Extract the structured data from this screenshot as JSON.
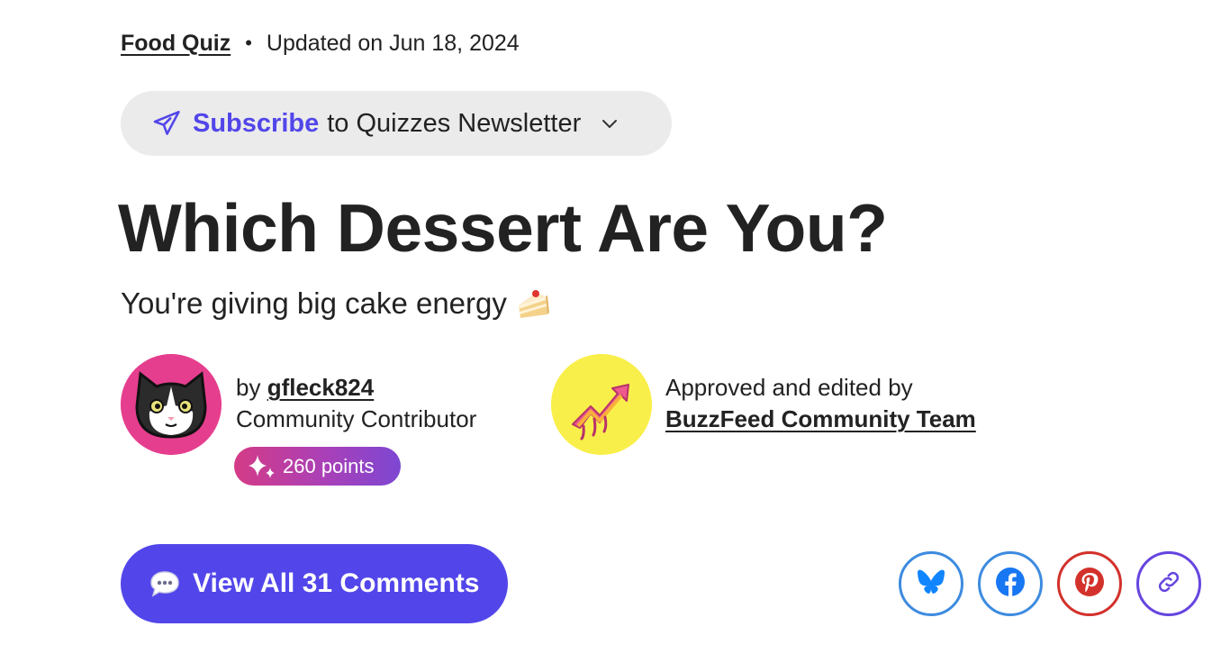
{
  "meta": {
    "category": "Food Quiz",
    "separator": "•",
    "updated": "Updated on Jun 18, 2024"
  },
  "subscribe": {
    "link_label": "Subscribe",
    "rest_label": "to Quizzes Newsletter",
    "icon": "send-icon",
    "dropdown_icon": "chevron-down-icon"
  },
  "quiz": {
    "title": "Which Dessert Are You?",
    "subtitle": "You're giving big cake energy"
  },
  "author": {
    "by_label": "by",
    "username": "gfleck824",
    "role": "Community Contributor",
    "points": "260 points",
    "avatar": "cat-avatar"
  },
  "approval": {
    "label": "Approved and edited by",
    "team": "BuzzFeed Community Team",
    "logo": "trending-arrow-logo"
  },
  "actions": {
    "comments_label": "View All 31 Comments",
    "comments_icon": "speech-bubble-icon",
    "share": [
      "bluesky-icon",
      "facebook-icon",
      "pinterest-icon",
      "link-icon"
    ]
  },
  "colors": {
    "accent": "#5246ea",
    "text": "#222222",
    "pill_bg": "#ebebeb",
    "avatar_bg": "#e63e8e",
    "approver_bg": "#f9ef4a",
    "bluesky": "#1185fe",
    "facebook": "#1877f2",
    "pinterest": "#d3312b",
    "link": "#6645df"
  }
}
